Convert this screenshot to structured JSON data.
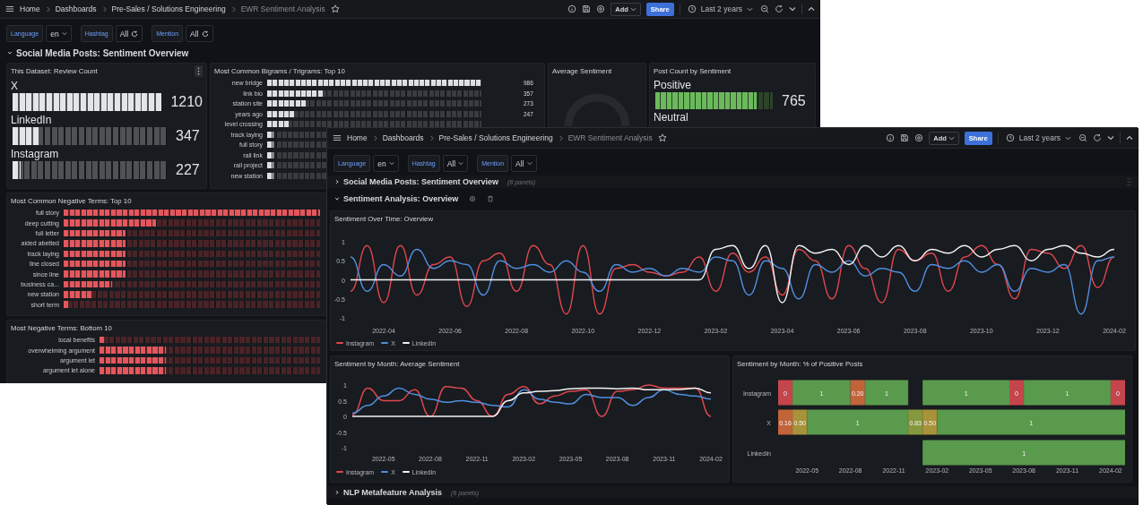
{
  "windows": [
    {
      "kind": "overview",
      "breadcrumbs": [
        {
          "label": "Home",
          "current": false
        },
        {
          "label": "Dashboards",
          "current": false
        },
        {
          "label": "Pre-Sales / Solutions Engineering",
          "current": false
        },
        {
          "label": "EWR Sentiment Analysis",
          "current": true
        }
      ],
      "add_button": "Add",
      "share_button": "Share",
      "time_range": "Last 2 years",
      "variables": [
        {
          "label": "Language",
          "value": "en",
          "loading": false
        },
        {
          "label": "Hashtag",
          "value": "All",
          "loading": true
        },
        {
          "label": "Mention",
          "value": "All",
          "loading": true
        }
      ],
      "row": {
        "title": "Social Media Posts: Sentiment Overview",
        "expanded": true
      },
      "review_count": {
        "title": "This Dataset: Review Count",
        "hovered": true,
        "items": [
          {
            "name": "X",
            "count": "1210",
            "level": 1
          },
          {
            "name": "LinkedIn",
            "count": "347",
            "level": 0.17
          },
          {
            "name": "Instagram",
            "count": "227",
            "level": 0.05
          }
        ]
      },
      "bigrams": {
        "title": "Most Common Bigrams / Trigrams: Top 10",
        "items": [
          {
            "term": "new bridge",
            "count": "986",
            "level": 1
          },
          {
            "term": "link bio",
            "count": "357",
            "level": 0.26
          },
          {
            "term": "station site",
            "count": "273",
            "level": 0.18
          },
          {
            "term": "years ago",
            "count": "247",
            "level": 0.13
          },
          {
            "term": "level crossing",
            "level": 0.1
          },
          {
            "term": "track laying",
            "level": 0.03
          },
          {
            "term": "full story",
            "level": 0.03
          },
          {
            "term": "rail link",
            "level": 0.03
          },
          {
            "term": "rail project",
            "level": 0.03
          },
          {
            "term": "new station",
            "level": 0.03
          }
        ]
      },
      "average_sentiment": {
        "title": "Average Sentiment"
      },
      "post_count": {
        "title": "Post Count by Sentiment",
        "items": [
          {
            "label": "Positive",
            "count": "765",
            "level": 0.86
          },
          {
            "label": "Neutral"
          }
        ]
      },
      "negative_top": {
        "title": "Most Common Negative Terms: Top 10",
        "items": [
          {
            "term": "full story",
            "level": 1
          },
          {
            "term": "deep cutting",
            "level": 0.36
          },
          {
            "term": "full letter",
            "level": 0.24
          },
          {
            "term": "aided abetted",
            "level": 0.24
          },
          {
            "term": "track laying",
            "level": 0.24
          },
          {
            "term": "line closed",
            "level": 0.24
          },
          {
            "term": "since line",
            "level": 0.24
          },
          {
            "term": "business ca...",
            "level": 0.19
          },
          {
            "term": "new station",
            "level": 0.11
          },
          {
            "term": "short term",
            "level": 0.02
          }
        ]
      },
      "negative_bottom": {
        "title": "Most Negative Terms: Bottom 10",
        "items": [
          {
            "term": "local benefits",
            "level": 0.025
          },
          {
            "term": "overwhelming argument",
            "level": 0.3
          },
          {
            "term": "argument let",
            "level": 0.3
          },
          {
            "term": "argument let alone",
            "level": 0.3
          }
        ]
      }
    },
    {
      "kind": "analysis",
      "breadcrumbs": [
        {
          "label": "Home",
          "current": false
        },
        {
          "label": "Dashboards",
          "current": false
        },
        {
          "label": "Pre-Sales / Solutions Engineering",
          "current": false
        },
        {
          "label": "EWR Sentiment Analysis",
          "current": true
        }
      ],
      "add_button": "Add",
      "share_button": "Share",
      "time_range": "Last 2 years",
      "variables": [
        {
          "label": "Language",
          "value": "en",
          "loading": false
        },
        {
          "label": "Hashtag",
          "value": "All",
          "loading": false
        },
        {
          "label": "Mention",
          "value": "All",
          "loading": false
        }
      ],
      "rows": [
        {
          "title": "Social Media Posts: Sentiment Overview",
          "expanded": false,
          "note": "(8 panels)",
          "hovered": false
        },
        {
          "title": "Sentiment Analysis: Overview",
          "expanded": true,
          "hovered": true
        }
      ],
      "over_time": {
        "title": "Sentiment Over Time: Overview",
        "chart_data": {
          "type": "line",
          "categories": [
            null,
            null,
            "2022-04",
            null,
            null,
            null,
            "2022-06",
            null,
            null,
            null,
            "2022-08",
            null,
            null,
            null,
            "2022-10",
            null,
            null,
            null,
            "2022-12",
            null,
            null,
            null,
            "2023-02",
            null,
            null,
            null,
            "2023-04",
            null,
            null,
            null,
            "2023-06",
            null,
            null,
            null,
            "2023-08",
            null,
            null,
            null,
            "2023-10",
            null,
            null,
            null,
            "2023-12",
            null,
            null,
            null,
            "2024-02"
          ],
          "ylim": [
            -1,
            1
          ],
          "yticks": [
            1,
            0.5,
            0,
            -0.5,
            -1
          ],
          "series": [
            {
              "name": "Instagram",
              "color": "#e0474f",
              "values": [
                -0.3,
                0.9,
                -0.6,
                0.9,
                -0.4,
                0.4,
                0.6,
                -0.7,
                0.5,
                0.7,
                -0.3,
                0.9,
                0.4,
                -0.9,
                0.9,
                -0.9,
                0.3,
                0.4,
                0.2,
                0.1,
                0.2,
                0.6,
                -0.3,
                0.7,
                0.2,
                0.6,
                -0.4,
                0.8,
                0.5,
                -0.5,
                0.9,
                0.3,
                -0.6,
                0.8,
                0.5,
                0.7,
                -0.3,
                0.6,
                0.9,
                0.4,
                -0.5,
                0.8,
                0.7,
                0.3,
                0.9,
                -0.2,
                0.6
              ]
            },
            {
              "name": "X",
              "color": "#4f8fe0",
              "values": [
                0.6,
                -0.3,
                0.4,
                0.1,
                0.8,
                0.3,
                0.5,
                0.4,
                -0.4,
                0.5,
                0.3,
                0.4,
                0.2,
                0.5,
                0.2,
                -0.3,
                0.4,
                0.2,
                0.3,
                0.1,
                0.3,
                0.2,
                0.6,
                0.5,
                -0.4,
                0.5,
                0.3,
                -0.5,
                0.4,
                0.2,
                0.5,
                0.1,
                0.3,
                0.2,
                -0.3,
                0.4,
                0.3,
                0.5,
                0.2,
                0.4,
                -0.3,
                0.3,
                0.2,
                0.4,
                -0.9,
                0.5,
                0.6
              ]
            },
            {
              "name": "LinkedIn",
              "color": "#f2f2f2",
              "values": [
                0,
                0,
                0,
                0,
                0,
                0,
                0,
                0,
                0,
                0,
                0,
                0,
                0,
                0,
                0,
                0,
                0,
                0,
                0,
                0,
                0,
                0,
                0.8,
                0.9,
                0.3,
                0.9,
                -0.6,
                0.9,
                0.7,
                0.8,
                0.4,
                0.9,
                0.6,
                0.9,
                0.5,
                0.8,
                0.7,
                0.9,
                0.6,
                0.8,
                0.9,
                0.5,
                0.8,
                0.9,
                0.7,
                0.6,
                0.8
              ]
            }
          ]
        }
      },
      "monthly_average": {
        "title": "Sentiment by Month: Average Sentiment",
        "chart_data": {
          "type": "line",
          "categories": [
            null,
            null,
            "2022-05",
            null,
            null,
            "2022-08",
            null,
            null,
            "2022-11",
            null,
            null,
            "2023-02",
            null,
            null,
            "2023-05",
            null,
            null,
            "2023-08",
            null,
            null,
            "2023-11",
            null,
            null,
            "2024-02"
          ],
          "ylim": [
            -1,
            1
          ],
          "yticks": [
            1,
            0.5,
            0,
            -0.5,
            -1
          ],
          "series": [
            {
              "name": "Instagram",
              "color": "#e0474f",
              "values": [
                0.05,
                0.9,
                0.5,
                0.5,
                0.85,
                0,
                0.95,
                0.9,
                0.5,
                0,
                0.7,
                0.95,
                0.4,
                0.65,
                0.8,
                0.85,
                0,
                0.8,
                0.85,
                1.0,
                0.9,
                0.9,
                0.9,
                0
              ]
            },
            {
              "name": "X",
              "color": "#4f8fe0",
              "values": [
                0.1,
                0.35,
                0.65,
                0.9,
                0.7,
                0.55,
                0.45,
                0.5,
                0.45,
                0.35,
                0.3,
                0.85,
                0.55,
                0.45,
                0.4,
                0.7,
                0.6,
                0.6,
                0.35,
                0.6,
                0.85,
                0.7,
                0.65,
                0.55
              ]
            },
            {
              "name": "LinkedIn",
              "color": "#f2f2f2",
              "values": [
                0,
                0,
                0,
                0,
                0,
                0,
                0,
                0,
                0,
                0,
                0.5,
                0.75,
                0.8,
                0.82,
                0.88,
                0.9,
                0.9,
                0.88,
                0.9,
                0.85,
                0.85,
                0.86,
                0.9,
                0.75
              ]
            }
          ]
        }
      },
      "positive_share": {
        "title": "Sentiment by Month: % of Positive Posts",
        "xticks": [
          "2022-05",
          "2022-08",
          "2022-11",
          "2023-02",
          "2023-05",
          "2023-08",
          "2023-11",
          "2024-02"
        ],
        "rows": [
          {
            "label": "Instagram",
            "months": [
              {
                "kind": "start",
                "text": "0",
                "color": "#c4464c"
              },
              {
                "kind": "start",
                "text": "1",
                "color": "#5a9a4c"
              },
              {
                "kind": "more"
              },
              {
                "kind": "more"
              },
              {
                "kind": "more"
              },
              {
                "kind": "start",
                "text": "0.20",
                "color": "#c2643a"
              },
              {
                "kind": "start",
                "text": "1",
                "color": "#5a9a4c"
              },
              {
                "kind": "more"
              },
              {
                "kind": "more"
              },
              {
                "kind": "empty"
              },
              {
                "kind": "start",
                "text": "1",
                "color": "#5a9a4c"
              },
              {
                "kind": "more"
              },
              {
                "kind": "more"
              },
              {
                "kind": "more"
              },
              {
                "kind": "more"
              },
              {
                "kind": "more"
              },
              {
                "kind": "start",
                "text": "0",
                "color": "#c4464c"
              },
              {
                "kind": "start",
                "text": "1",
                "color": "#5a9a4c"
              },
              {
                "kind": "more"
              },
              {
                "kind": "more"
              },
              {
                "kind": "more"
              },
              {
                "kind": "more"
              },
              {
                "kind": "more"
              },
              {
                "kind": "start",
                "text": "0",
                "color": "#c4464c"
              }
            ]
          },
          {
            "label": "X",
            "months": [
              {
                "kind": "start",
                "text": "0.16",
                "color": "#c2643a"
              },
              {
                "kind": "start",
                "text": "0.50",
                "color": "#a8923a"
              },
              {
                "kind": "start",
                "text": "1",
                "color": "#5a9a4c"
              },
              {
                "kind": "more"
              },
              {
                "kind": "more"
              },
              {
                "kind": "more"
              },
              {
                "kind": "more"
              },
              {
                "kind": "more"
              },
              {
                "kind": "more"
              },
              {
                "kind": "start",
                "text": "0.83",
                "color": "#86983e"
              },
              {
                "kind": "start",
                "text": "0.50",
                "color": "#a8923a"
              },
              {
                "kind": "start",
                "text": "1",
                "color": "#5a9a4c"
              },
              {
                "kind": "more"
              },
              {
                "kind": "more"
              },
              {
                "kind": "more"
              },
              {
                "kind": "more"
              },
              {
                "kind": "more"
              },
              {
                "kind": "more"
              },
              {
                "kind": "more"
              },
              {
                "kind": "more"
              },
              {
                "kind": "more"
              },
              {
                "kind": "more"
              },
              {
                "kind": "more"
              },
              {
                "kind": "more"
              }
            ]
          },
          {
            "label": "LinkedIn",
            "months": [
              {
                "kind": "empty"
              },
              {
                "kind": "empty"
              },
              {
                "kind": "empty"
              },
              {
                "kind": "empty"
              },
              {
                "kind": "empty"
              },
              {
                "kind": "empty"
              },
              {
                "kind": "empty"
              },
              {
                "kind": "empty"
              },
              {
                "kind": "empty"
              },
              {
                "kind": "empty"
              },
              {
                "kind": "start",
                "text": "1",
                "color": "#5a9a4c"
              },
              {
                "kind": "more"
              },
              {
                "kind": "more"
              },
              {
                "kind": "more"
              },
              {
                "kind": "more"
              },
              {
                "kind": "more"
              },
              {
                "kind": "more"
              },
              {
                "kind": "more"
              },
              {
                "kind": "more"
              },
              {
                "kind": "more"
              },
              {
                "kind": "more"
              },
              {
                "kind": "more"
              },
              {
                "kind": "more"
              },
              {
                "kind": "more"
              }
            ]
          }
        ]
      },
      "footer_row": {
        "title": "NLP Metafeature Analysis",
        "expanded": false,
        "note": "(6 panels)"
      }
    }
  ]
}
